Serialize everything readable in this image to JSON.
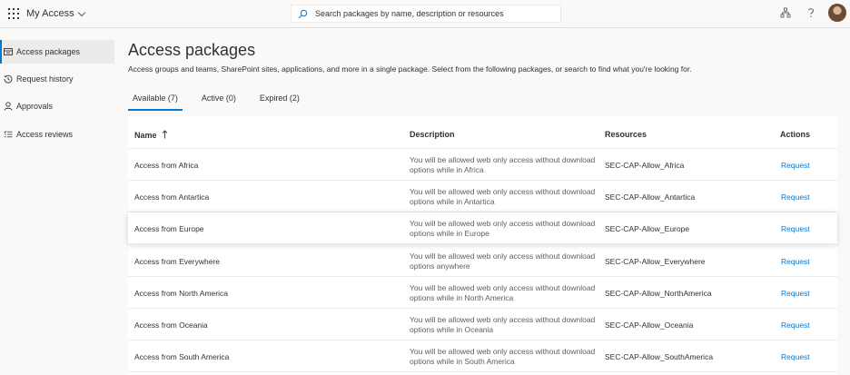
{
  "app": {
    "title": "My Access"
  },
  "search": {
    "placeholder": "Search packages by name, description or resources"
  },
  "sidebar": {
    "items": [
      {
        "label": "Access packages",
        "icon": "package-icon",
        "active": true
      },
      {
        "label": "Request history",
        "icon": "history-icon",
        "active": false
      },
      {
        "label": "Approvals",
        "icon": "person-icon",
        "active": false
      },
      {
        "label": "Access reviews",
        "icon": "review-list-icon",
        "active": false
      }
    ]
  },
  "main": {
    "title": "Access packages",
    "description": "Access groups and teams, SharePoint sites, applications, and more in a single package. Select from the following packages, or search to find what you're looking for.",
    "tabs": [
      {
        "label": "Available (7)",
        "active": true
      },
      {
        "label": "Active (0)",
        "active": false
      },
      {
        "label": "Expired (2)",
        "active": false
      }
    ]
  },
  "table": {
    "headers": {
      "name": "Name",
      "description": "Description",
      "resources": "Resources",
      "actions": "Actions"
    },
    "rows": [
      {
        "name": "Access from Africa",
        "description": "You will be allowed web only access without download options while in Africa",
        "resource": "SEC-CAP-Allow_Africa",
        "action": "Request"
      },
      {
        "name": "Access from Antartica",
        "description": "You will be allowed web only access without download options while in Antartica",
        "resource": "SEC-CAP-Allow_Antartica",
        "action": "Request"
      },
      {
        "name": "Access from Europe",
        "description": "You will be allowed web only access without download options while in Europe",
        "resource": "SEC-CAP-Allow_Europe",
        "action": "Request"
      },
      {
        "name": "Access from Everywhere",
        "description": "You will be allowed web only access without download options anywhere",
        "resource": "SEC-CAP-Allow_Everywhere",
        "action": "Request"
      },
      {
        "name": "Access from North America",
        "description": "You will be allowed web only access without download options while in North America",
        "resource": "SEC-CAP-Allow_NorthAmerica",
        "action": "Request"
      },
      {
        "name": "Access from Oceania",
        "description": "You will be allowed web only access without download options while in Oceania",
        "resource": "SEC-CAP-Allow_Oceania",
        "action": "Request"
      },
      {
        "name": "Access from South America",
        "description": "You will be allowed web only access without download options while in South America",
        "resource": "SEC-CAP-Allow_SouthAmerica",
        "action": "Request"
      }
    ]
  },
  "colors": {
    "accent": "#0078d4",
    "background": "#faf9f8",
    "text": "#323130"
  }
}
